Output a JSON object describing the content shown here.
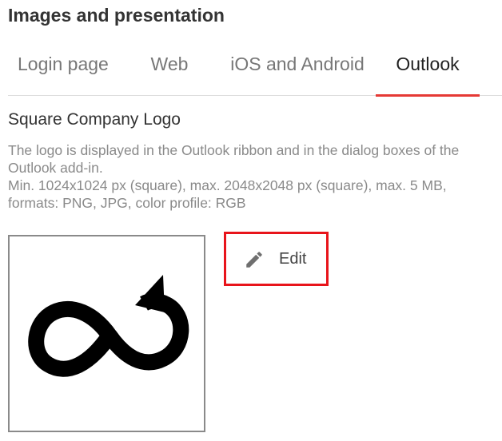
{
  "section": {
    "title": "Images and presentation"
  },
  "tabs": [
    {
      "label": "Login page",
      "active": false
    },
    {
      "label": "Web",
      "active": false
    },
    {
      "label": "iOS and Android",
      "active": false
    },
    {
      "label": "Outlook",
      "active": true
    }
  ],
  "field": {
    "title": "Square Company Logo",
    "description_line1": "The logo is displayed in the Outlook ribbon and in the dialog boxes of the Outlook add-in.",
    "description_line2": "Min. 1024x1024 px (square), max. 2048x2048 px (square), max. 5 MB, formats: PNG, JPG, color profile: RGB"
  },
  "edit_button": {
    "label": "Edit",
    "icon": "pencil-icon"
  },
  "logo": {
    "icon": "infinity-loop-logo"
  },
  "colors": {
    "accent": "#e53935",
    "highlight_border": "#e8141b",
    "muted_text": "#8a8a8a",
    "tab_inactive": "#777777"
  }
}
